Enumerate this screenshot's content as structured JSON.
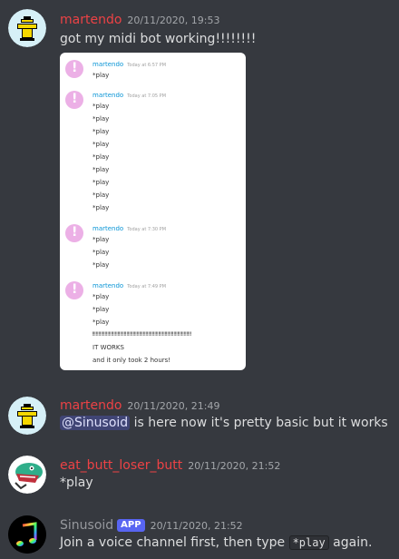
{
  "messages": [
    {
      "username": "martendo",
      "username_color": "#ed4245",
      "timestamp": "20/11/2020, 19:53",
      "text": "got my midi bot working!!!!!!!!"
    },
    {
      "username": "martendo",
      "username_color": "#ed4245",
      "timestamp": "20/11/2020, 21:49",
      "mention": "@Sinusoid",
      "text": " is here now it's pretty basic but it works"
    },
    {
      "username": "eat_butt_loser_butt",
      "username_color": "#ed4245",
      "timestamp": "20/11/2020, 21:52",
      "text": "*play"
    },
    {
      "username": "Sinusoid",
      "username_color": "#96989d",
      "badge": "APP",
      "timestamp": "20/11/2020, 21:52",
      "text_before": "Join a voice channel first, then type ",
      "code": "*play",
      "text_after": " again."
    }
  ],
  "embed": {
    "groups": [
      {
        "username": "martendo",
        "timestamp": "Today at 6:57 PM",
        "lines": [
          "*play"
        ]
      },
      {
        "username": "martendo",
        "timestamp": "Today at 7:05 PM",
        "lines": [
          "*play",
          "*play",
          "*play",
          "*play",
          "*play",
          "*play",
          "*play",
          "*play",
          "*play"
        ]
      },
      {
        "username": "martendo",
        "timestamp": "Today at 7:30 PM",
        "lines": [
          "*play",
          "*play",
          "*play"
        ]
      },
      {
        "username": "martendo",
        "timestamp": "Today at 7:49 PM",
        "lines": [
          "*play",
          "*play",
          "*play",
          "!!!!!!!!!!!!!!!!!!!!!!!!!!!!!!!!!!!!!!!!!!!!!!!!!!!!!!!!!!!!!!!!!!!!!!!!!!!!!!",
          "IT WORKS",
          "and it only took 2 hours!"
        ]
      }
    ]
  },
  "colors": {
    "background": "#36393f",
    "text": "#dcddde",
    "timestamp": "#a3a6aa",
    "mention_bg": "#4e5592",
    "badge_bg": "#5865f2"
  }
}
